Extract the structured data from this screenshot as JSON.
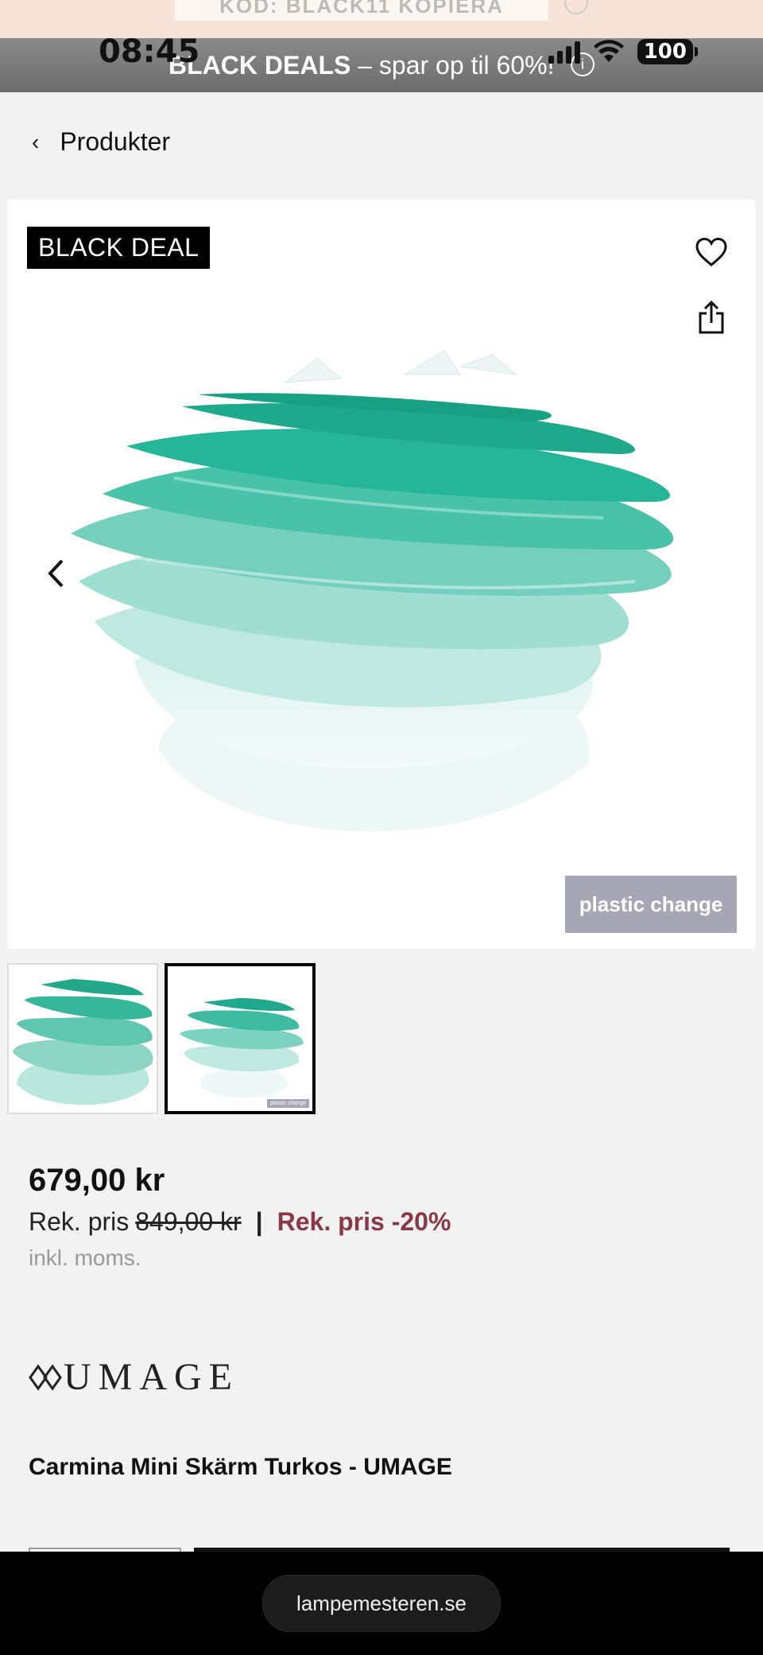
{
  "promo": {
    "code_text": "KOD: BLACK11  KOPIERA"
  },
  "status_bar": {
    "time": "08:45",
    "battery": "100"
  },
  "deal_bar": {
    "bold": "BLACK DEALS",
    "rest": " – spar op til 60%!",
    "info_icon": "info-icon"
  },
  "nav": {
    "back_label": "Produkter"
  },
  "gallery": {
    "badge": "BLACK DEAL",
    "watermark": "plastic change",
    "thumb_watermark": "plastic change",
    "icons": [
      "heart-icon",
      "share-icon",
      "chevron-left-icon"
    ]
  },
  "price": {
    "current": "679,00 kr",
    "rek_label": "Rek. pris",
    "rek_old": "849,00 kr",
    "separator": "|",
    "discount": "Rek. pris -20%",
    "vat": "inkl. moms."
  },
  "brand": {
    "name": "UMAGE"
  },
  "product": {
    "title": "Carmina Mini Skärm Turkos - UMAGE"
  },
  "browser": {
    "url": "lampemesteren.se"
  },
  "colors": {
    "accent_discount": "#8a3846",
    "lamp_turquoise": "#1fb59a",
    "badge_bg": "#000000"
  }
}
